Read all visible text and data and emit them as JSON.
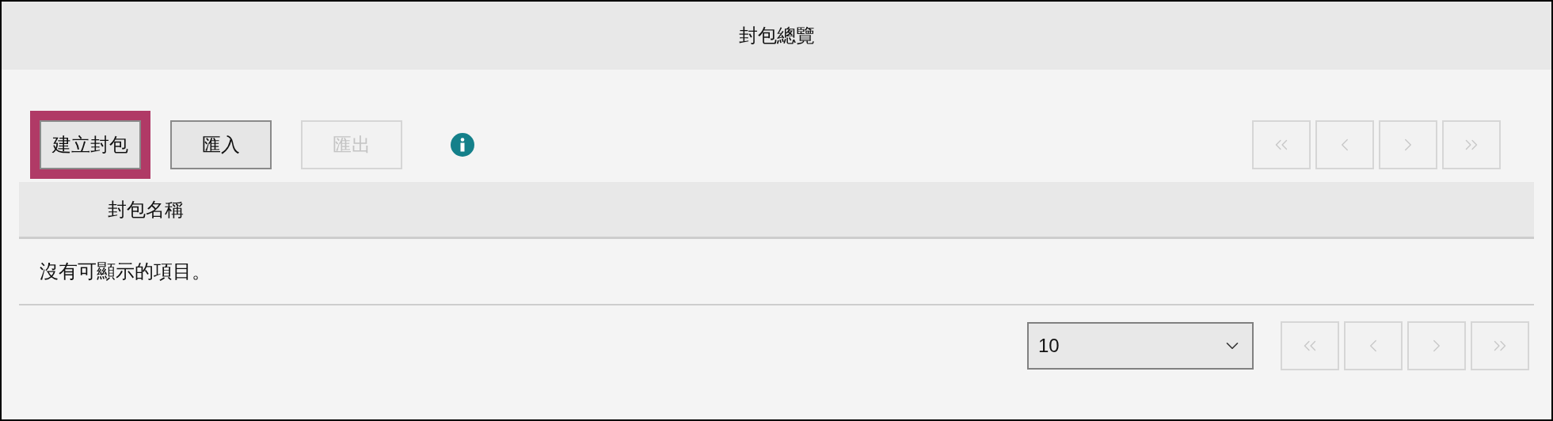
{
  "window": {
    "title": "封包總覽"
  },
  "toolbar": [
    {
      "label": "建立封包",
      "disabled": false,
      "highlighted": true
    },
    {
      "label": "匯入",
      "disabled": false,
      "highlighted": false
    },
    {
      "label": "匯出",
      "disabled": true,
      "highlighted": false
    }
  ],
  "top_pager": [
    {
      "kind": "first",
      "disabled": true
    },
    {
      "kind": "previous",
      "disabled": true
    },
    {
      "kind": "next",
      "disabled": true
    },
    {
      "kind": "last",
      "disabled": true
    }
  ],
  "table": {
    "columns": [
      "封包名稱"
    ],
    "empty_message": "沒有可顯示的項目。"
  },
  "page_size": {
    "value": "10"
  },
  "bottom_pager": [
    {
      "kind": "first",
      "disabled": true
    },
    {
      "kind": "previous",
      "disabled": true
    },
    {
      "kind": "next",
      "disabled": true
    },
    {
      "kind": "last",
      "disabled": true
    }
  ]
}
